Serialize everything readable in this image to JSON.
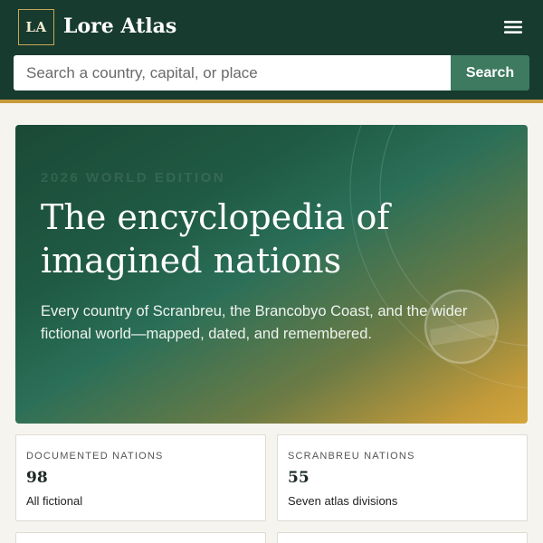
{
  "header": {
    "logo_text": "LA",
    "app_name": "Lore Atlas",
    "menu_icon": "hamburger-menu-icon",
    "background_color": "#173b2e",
    "accent_color": "#c89a3c"
  },
  "search": {
    "placeholder": "Search a country, capital, or place",
    "value": "",
    "button_label": "Search",
    "button_color": "#3d7a60"
  },
  "hero": {
    "eyebrow": "2026 WORLD EDITION",
    "title": "The encyclopedia of imagined nations",
    "subtitle": "Every country of Scranbreu, the Brancobyo Coast, and the wider fictional world—mapped, dated, and remembered."
  },
  "stats": [
    {
      "label": "DOCUMENTED NATIONS",
      "value": "98",
      "description": "All fictional"
    },
    {
      "label": "SCRANBREU NATIONS",
      "value": "55",
      "description": "Seven atlas divisions"
    }
  ]
}
